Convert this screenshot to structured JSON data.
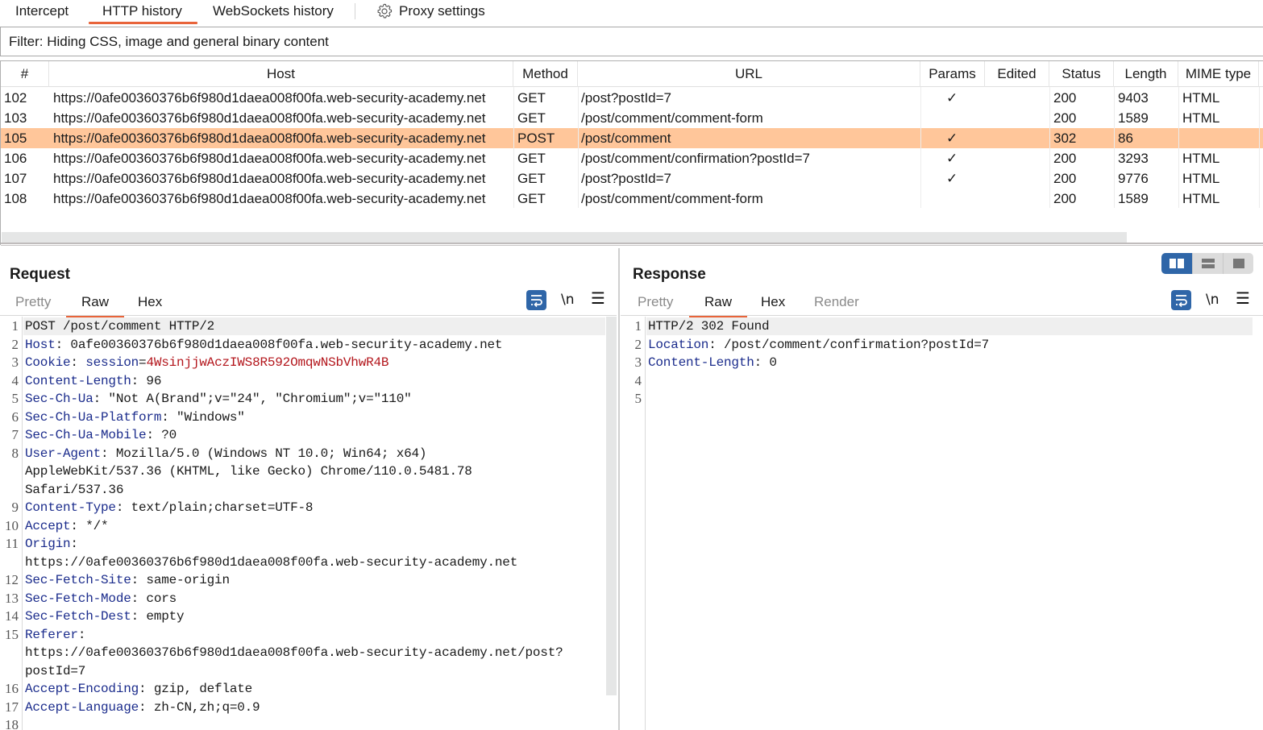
{
  "top_tabs": [
    {
      "label": "Intercept",
      "active": false
    },
    {
      "label": "HTTP history",
      "active": true
    },
    {
      "label": "WebSockets history",
      "active": false
    },
    {
      "label": "Proxy settings",
      "icon": "gear-icon",
      "active": false
    }
  ],
  "filter": {
    "text": "Filter: Hiding CSS, image and general binary content"
  },
  "table": {
    "columns": [
      "#",
      "Host",
      "Method",
      "URL",
      "Params",
      "Edited",
      "Status",
      "Length",
      "MIME type"
    ],
    "rows": [
      {
        "num": "102",
        "host": "https://0afe00360376b6f980d1daea008f00fa.web-security-academy.net",
        "method": "GET",
        "url": "/post?postId=7",
        "params": "✓",
        "edited": "",
        "status": "200",
        "length": "9403",
        "mime": "HTML",
        "selected": false
      },
      {
        "num": "103",
        "host": "https://0afe00360376b6f980d1daea008f00fa.web-security-academy.net",
        "method": "GET",
        "url": "/post/comment/comment-form",
        "params": "",
        "edited": "",
        "status": "200",
        "length": "1589",
        "mime": "HTML",
        "selected": false
      },
      {
        "num": "105",
        "host": "https://0afe00360376b6f980d1daea008f00fa.web-security-academy.net",
        "method": "POST",
        "url": "/post/comment",
        "params": "✓",
        "edited": "",
        "status": "302",
        "length": "86",
        "mime": "",
        "selected": true
      },
      {
        "num": "106",
        "host": "https://0afe00360376b6f980d1daea008f00fa.web-security-academy.net",
        "method": "GET",
        "url": "/post/comment/confirmation?postId=7",
        "params": "✓",
        "edited": "",
        "status": "200",
        "length": "3293",
        "mime": "HTML",
        "selected": false
      },
      {
        "num": "107",
        "host": "https://0afe00360376b6f980d1daea008f00fa.web-security-academy.net",
        "method": "GET",
        "url": "/post?postId=7",
        "params": "✓",
        "edited": "",
        "status": "200",
        "length": "9776",
        "mime": "HTML",
        "selected": false
      },
      {
        "num": "108",
        "host": "https://0afe00360376b6f980d1daea008f00fa.web-security-academy.net",
        "method": "GET",
        "url": "/post/comment/comment-form",
        "params": "",
        "edited": "",
        "status": "200",
        "length": "1589",
        "mime": "HTML",
        "selected": false
      }
    ],
    "selected_color": "#ffc69a"
  },
  "request": {
    "title": "Request",
    "tabs": [
      {
        "label": "Pretty",
        "active": false
      },
      {
        "label": "Raw",
        "active": true
      },
      {
        "label": "Hex",
        "active": false
      }
    ],
    "toolbar": {
      "wrap": "word-wrap-icon",
      "newline": "\\n",
      "menu": "hamburger-menu-icon"
    },
    "lines": [
      {
        "n": "1",
        "parts": [
          {
            "t": "POST /post/comment HTTP/2",
            "c": ""
          }
        ]
      },
      {
        "n": "2",
        "parts": [
          {
            "t": "Host",
            "c": "hk"
          },
          {
            "t": ": 0afe00360376b6f980d1daea008f00fa.web-security-academy.net",
            "c": ""
          }
        ]
      },
      {
        "n": "3",
        "parts": [
          {
            "t": "Cookie",
            "c": "hk"
          },
          {
            "t": ": ",
            "c": ""
          },
          {
            "t": "session",
            "c": "ck"
          },
          {
            "t": "=",
            "c": ""
          },
          {
            "t": "4WsinjjwAczIWS8R592OmqwNSbVhwR4B",
            "c": "cv"
          }
        ]
      },
      {
        "n": "4",
        "parts": [
          {
            "t": "Content-Length",
            "c": "hk"
          },
          {
            "t": ": 96",
            "c": ""
          }
        ]
      },
      {
        "n": "5",
        "parts": [
          {
            "t": "Sec-Ch-Ua",
            "c": "hk"
          },
          {
            "t": ": \"Not A(Brand\";v=\"24\", \"Chromium\";v=\"110\"",
            "c": ""
          }
        ]
      },
      {
        "n": "6",
        "parts": [
          {
            "t": "Sec-Ch-Ua-Platform",
            "c": "hk"
          },
          {
            "t": ": \"Windows\"",
            "c": ""
          }
        ]
      },
      {
        "n": "7",
        "parts": [
          {
            "t": "Sec-Ch-Ua-Mobile",
            "c": "hk"
          },
          {
            "t": ": ?0",
            "c": ""
          }
        ]
      },
      {
        "n": "8",
        "parts": [
          {
            "t": "User-Agent",
            "c": "hk"
          },
          {
            "t": ": Mozilla/5.0 (Windows NT 10.0; Win64; x64)",
            "c": ""
          }
        ]
      },
      {
        "n": "",
        "parts": [
          {
            "t": "AppleWebKit/537.36 (KHTML, like Gecko) Chrome/110.0.5481.78",
            "c": ""
          }
        ]
      },
      {
        "n": "",
        "parts": [
          {
            "t": "Safari/537.36",
            "c": ""
          }
        ]
      },
      {
        "n": "9",
        "parts": [
          {
            "t": "Content-Type",
            "c": "hk"
          },
          {
            "t": ": text/plain;charset=UTF-8",
            "c": ""
          }
        ]
      },
      {
        "n": "10",
        "parts": [
          {
            "t": "Accept",
            "c": "hk"
          },
          {
            "t": ": */*",
            "c": ""
          }
        ]
      },
      {
        "n": "11",
        "parts": [
          {
            "t": "Origin",
            "c": "hk"
          },
          {
            "t": ":",
            "c": ""
          }
        ]
      },
      {
        "n": "",
        "parts": [
          {
            "t": "https://0afe00360376b6f980d1daea008f00fa.web-security-academy.net",
            "c": ""
          }
        ]
      },
      {
        "n": "12",
        "parts": [
          {
            "t": "Sec-Fetch-Site",
            "c": "hk"
          },
          {
            "t": ": same-origin",
            "c": ""
          }
        ]
      },
      {
        "n": "13",
        "parts": [
          {
            "t": "Sec-Fetch-Mode",
            "c": "hk"
          },
          {
            "t": ": cors",
            "c": ""
          }
        ]
      },
      {
        "n": "14",
        "parts": [
          {
            "t": "Sec-Fetch-Dest",
            "c": "hk"
          },
          {
            "t": ": empty",
            "c": ""
          }
        ]
      },
      {
        "n": "15",
        "parts": [
          {
            "t": "Referer",
            "c": "hk"
          },
          {
            "t": ":",
            "c": ""
          }
        ]
      },
      {
        "n": "",
        "parts": [
          {
            "t": "https://0afe00360376b6f980d1daea008f00fa.web-security-academy.net/post?",
            "c": ""
          }
        ]
      },
      {
        "n": "",
        "parts": [
          {
            "t": "postId=7",
            "c": ""
          }
        ]
      },
      {
        "n": "16",
        "parts": [
          {
            "t": "Accept-Encoding",
            "c": "hk"
          },
          {
            "t": ": gzip, deflate",
            "c": ""
          }
        ]
      },
      {
        "n": "17",
        "parts": [
          {
            "t": "Accept-Language",
            "c": "hk"
          },
          {
            "t": ": zh-CN,zh;q=0.9",
            "c": ""
          }
        ]
      },
      {
        "n": "18",
        "parts": []
      }
    ]
  },
  "response": {
    "title": "Response",
    "tabs": [
      {
        "label": "Pretty",
        "active": false
      },
      {
        "label": "Raw",
        "active": true
      },
      {
        "label": "Hex",
        "active": false
      },
      {
        "label": "Render",
        "active": false
      }
    ],
    "toolbar": {
      "wrap": "word-wrap-icon",
      "newline": "\\n",
      "menu": "hamburger-menu-icon"
    },
    "lines": [
      {
        "n": "1",
        "parts": [
          {
            "t": "HTTP/2 302 Found",
            "c": ""
          }
        ]
      },
      {
        "n": "2",
        "parts": [
          {
            "t": "Location",
            "c": "hk"
          },
          {
            "t": ": /post/comment/confirmation?postId=7",
            "c": ""
          }
        ]
      },
      {
        "n": "3",
        "parts": [
          {
            "t": "Content-Length",
            "c": "hk"
          },
          {
            "t": ": 0",
            "c": ""
          }
        ]
      },
      {
        "n": "4",
        "parts": []
      },
      {
        "n": "5",
        "parts": []
      }
    ]
  },
  "layout_buttons": [
    {
      "name": "side-by-side-layout-icon",
      "active": true
    },
    {
      "name": "stacked-layout-icon",
      "active": false
    },
    {
      "name": "single-pane-layout-icon",
      "active": false
    }
  ],
  "colors": {
    "accent": "#e8643a",
    "selection": "#ffc69a",
    "button_blue": "#2f66a8",
    "header_key": "#1b2c8c",
    "cookie_value": "#b3161c"
  }
}
